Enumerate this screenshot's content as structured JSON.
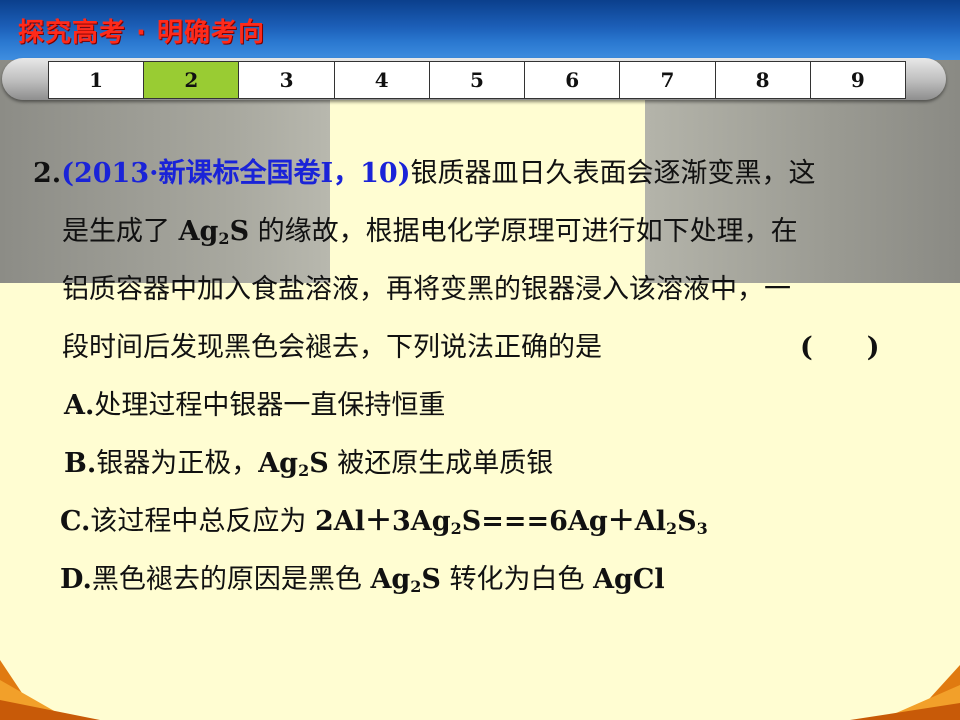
{
  "header": {
    "title": "探究高考 · 明确考向"
  },
  "nav": {
    "items": [
      "1",
      "2",
      "3",
      "4",
      "5",
      "6",
      "7",
      "8",
      "9"
    ],
    "active_index": 1
  },
  "question": {
    "number": "2.",
    "source": "(2013·新课标全国卷Ⅰ，10)",
    "line1_text": "银质器皿日久表面会逐渐变黑，这",
    "line2_pre": "是生成了 ",
    "line2_chem_ag": "Ag",
    "line2_chem_sub": "2",
    "line2_chem_s": "S",
    "line2_post": " 的缘故，根据电化学原理可进行如下处理，在",
    "line3": "铝质容器中加入食盐溶液，再将变黑的银器浸入该溶液中，一",
    "line4": "段时间后发现黑色会褪去，下列说法正确的是",
    "paren": "(　　)"
  },
  "options": {
    "A": {
      "letter": "A.",
      "text": "处理过程中银器一直保持恒重"
    },
    "B": {
      "letter": "B.",
      "pre": "银器为正极，",
      "ag": "Ag",
      "sub": "2",
      "s": "S",
      "post": " 被还原生成单质银"
    },
    "C": {
      "letter": "C.",
      "pre": "该过程中总反应为 ",
      "eq1": "2Al＋3Ag",
      "sub1": "2",
      "eq2": "S===6Ag＋Al",
      "sub2": "2",
      "eq3": "S",
      "sub3": "3"
    },
    "D": {
      "letter": "D.",
      "pre": "黑色褪去的原因是黑色 ",
      "ag": "Ag",
      "sub": "2",
      "s": "S",
      "mid": " 转化为白色 ",
      "agcl": "AgCl"
    }
  },
  "colors": {
    "header_bg": "#1c5fb8",
    "title": "#ff2a1a",
    "active_tab": "#99cc33",
    "page_bg": "#fffdd2",
    "source_blue": "#1a23d8"
  }
}
